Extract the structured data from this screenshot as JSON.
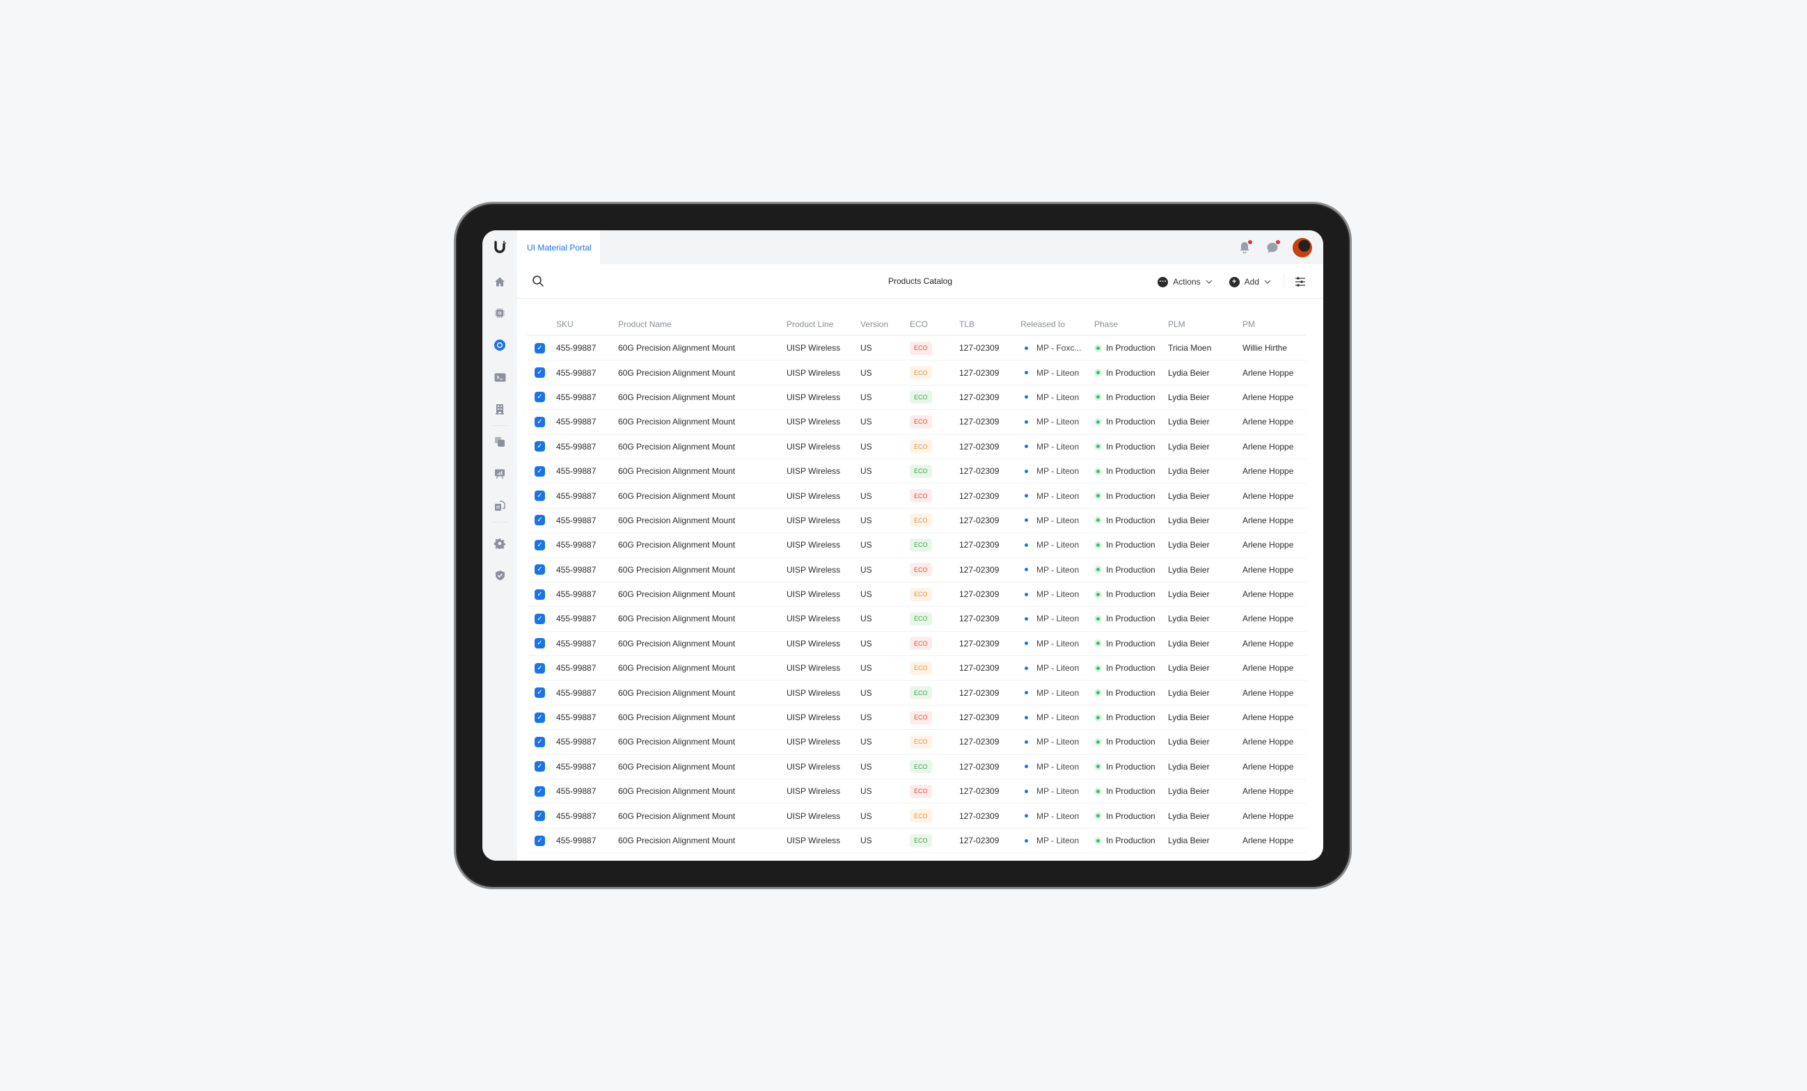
{
  "app": {
    "tab_label": "UI Material Portal",
    "page_title": "Products Catalog"
  },
  "sidebar": {
    "items": [
      {
        "icon": "home-icon",
        "active": false
      },
      {
        "icon": "chip-icon",
        "active": false
      },
      {
        "icon": "circle-icon",
        "active": true
      },
      {
        "icon": "terminal-icon",
        "active": false
      },
      {
        "icon": "building-icon",
        "active": false
      },
      {
        "icon": "copy-icon",
        "active": false
      },
      {
        "icon": "presentation-chart-icon",
        "active": false
      },
      {
        "icon": "documents-icon",
        "active": false
      },
      {
        "icon": "gear-icon",
        "active": false
      },
      {
        "icon": "shield-check-icon",
        "active": false
      }
    ]
  },
  "topbar": {
    "notifications": {
      "icon": "bell-icon",
      "has_unread": true
    },
    "messages": {
      "icon": "chat-icon",
      "has_unread": true
    }
  },
  "toolbar": {
    "actions_label": "Actions",
    "add_label": "Add"
  },
  "colors": {
    "accent": "#1a73e8",
    "eco_red": "#e0513a",
    "eco_orange": "#e39440",
    "eco_green": "#3aa54a",
    "phase_green": "#34c26a"
  },
  "table": {
    "columns": [
      "SKU",
      "Product Name",
      "Product Line",
      "Version",
      "ECO",
      "TLB",
      "Released to",
      "Phase",
      "PLM",
      "PM"
    ],
    "rows": [
      {
        "checked": true,
        "sku": "455-99887",
        "name": "60G Precision Alignment Mount",
        "line": "UISP Wireless",
        "version": "US",
        "eco": "ECO",
        "eco_status": "red",
        "tlb": "127-02309",
        "released": "MP - Foxc...",
        "phase": "In Production",
        "plm": "Tricia Moen",
        "pm": "Willie Hirthe"
      },
      {
        "checked": true,
        "sku": "455-99887",
        "name": "60G Precision Alignment Mount",
        "line": "UISP Wireless",
        "version": "US",
        "eco": "ECO",
        "eco_status": "orange",
        "tlb": "127-02309",
        "released": "MP - Liteon",
        "phase": "In Production",
        "plm": "Lydia Beier",
        "pm": "Arlene Hoppe"
      },
      {
        "checked": true,
        "sku": "455-99887",
        "name": "60G Precision Alignment Mount",
        "line": "UISP Wireless",
        "version": "US",
        "eco": "ECO",
        "eco_status": "green",
        "tlb": "127-02309",
        "released": "MP - Liteon",
        "phase": "In Production",
        "plm": "Lydia Beier",
        "pm": "Arlene Hoppe"
      },
      {
        "checked": true,
        "sku": "455-99887",
        "name": "60G Precision Alignment Mount",
        "line": "UISP Wireless",
        "version": "US",
        "eco": "ECO",
        "eco_status": "red",
        "tlb": "127-02309",
        "released": "MP - Liteon",
        "phase": "In Production",
        "plm": "Lydia Beier",
        "pm": "Arlene Hoppe"
      },
      {
        "checked": true,
        "sku": "455-99887",
        "name": "60G Precision Alignment Mount",
        "line": "UISP Wireless",
        "version": "US",
        "eco": "ECO",
        "eco_status": "orange",
        "tlb": "127-02309",
        "released": "MP - Liteon",
        "phase": "In Production",
        "plm": "Lydia Beier",
        "pm": "Arlene Hoppe"
      },
      {
        "checked": true,
        "sku": "455-99887",
        "name": "60G Precision Alignment Mount",
        "line": "UISP Wireless",
        "version": "US",
        "eco": "ECO",
        "eco_status": "green",
        "tlb": "127-02309",
        "released": "MP - Liteon",
        "phase": "In Production",
        "plm": "Lydia Beier",
        "pm": "Arlene Hoppe"
      },
      {
        "checked": true,
        "sku": "455-99887",
        "name": "60G Precision Alignment Mount",
        "line": "UISP Wireless",
        "version": "US",
        "eco": "ECO",
        "eco_status": "red",
        "tlb": "127-02309",
        "released": "MP - Liteon",
        "phase": "In Production",
        "plm": "Lydia Beier",
        "pm": "Arlene Hoppe"
      },
      {
        "checked": true,
        "sku": "455-99887",
        "name": "60G Precision Alignment Mount",
        "line": "UISP Wireless",
        "version": "US",
        "eco": "ECO",
        "eco_status": "orange",
        "tlb": "127-02309",
        "released": "MP - Liteon",
        "phase": "In Production",
        "plm": "Lydia Beier",
        "pm": "Arlene Hoppe"
      },
      {
        "checked": true,
        "sku": "455-99887",
        "name": "60G Precision Alignment Mount",
        "line": "UISP Wireless",
        "version": "US",
        "eco": "ECO",
        "eco_status": "green",
        "tlb": "127-02309",
        "released": "MP - Liteon",
        "phase": "In Production",
        "plm": "Lydia Beier",
        "pm": "Arlene Hoppe"
      },
      {
        "checked": true,
        "sku": "455-99887",
        "name": "60G Precision Alignment Mount",
        "line": "UISP Wireless",
        "version": "US",
        "eco": "ECO",
        "eco_status": "red",
        "tlb": "127-02309",
        "released": "MP - Liteon",
        "phase": "In Production",
        "plm": "Lydia Beier",
        "pm": "Arlene Hoppe"
      },
      {
        "checked": true,
        "sku": "455-99887",
        "name": "60G Precision Alignment Mount",
        "line": "UISP Wireless",
        "version": "US",
        "eco": "ECO",
        "eco_status": "orange",
        "tlb": "127-02309",
        "released": "MP - Liteon",
        "phase": "In Production",
        "plm": "Lydia Beier",
        "pm": "Arlene Hoppe"
      },
      {
        "checked": true,
        "sku": "455-99887",
        "name": "60G Precision Alignment Mount",
        "line": "UISP Wireless",
        "version": "US",
        "eco": "ECO",
        "eco_status": "green",
        "tlb": "127-02309",
        "released": "MP - Liteon",
        "phase": "In Production",
        "plm": "Lydia Beier",
        "pm": "Arlene Hoppe"
      },
      {
        "checked": true,
        "sku": "455-99887",
        "name": "60G Precision Alignment Mount",
        "line": "UISP Wireless",
        "version": "US",
        "eco": "ECO",
        "eco_status": "red",
        "tlb": "127-02309",
        "released": "MP - Liteon",
        "phase": "In Production",
        "plm": "Lydia Beier",
        "pm": "Arlene Hoppe"
      },
      {
        "checked": true,
        "sku": "455-99887",
        "name": "60G Precision Alignment Mount",
        "line": "UISP Wireless",
        "version": "US",
        "eco": "ECO",
        "eco_status": "orange",
        "tlb": "127-02309",
        "released": "MP - Liteon",
        "phase": "In Production",
        "plm": "Lydia Beier",
        "pm": "Arlene Hoppe"
      },
      {
        "checked": true,
        "sku": "455-99887",
        "name": "60G Precision Alignment Mount",
        "line": "UISP Wireless",
        "version": "US",
        "eco": "ECO",
        "eco_status": "green",
        "tlb": "127-02309",
        "released": "MP - Liteon",
        "phase": "In Production",
        "plm": "Lydia Beier",
        "pm": "Arlene Hoppe"
      },
      {
        "checked": true,
        "sku": "455-99887",
        "name": "60G Precision Alignment Mount",
        "line": "UISP Wireless",
        "version": "US",
        "eco": "ECO",
        "eco_status": "red",
        "tlb": "127-02309",
        "released": "MP - Liteon",
        "phase": "In Production",
        "plm": "Lydia Beier",
        "pm": "Arlene Hoppe"
      },
      {
        "checked": true,
        "sku": "455-99887",
        "name": "60G Precision Alignment Mount",
        "line": "UISP Wireless",
        "version": "US",
        "eco": "ECO",
        "eco_status": "orange",
        "tlb": "127-02309",
        "released": "MP - Liteon",
        "phase": "In Production",
        "plm": "Lydia Beier",
        "pm": "Arlene Hoppe"
      },
      {
        "checked": true,
        "sku": "455-99887",
        "name": "60G Precision Alignment Mount",
        "line": "UISP Wireless",
        "version": "US",
        "eco": "ECO",
        "eco_status": "green",
        "tlb": "127-02309",
        "released": "MP - Liteon",
        "phase": "In Production",
        "plm": "Lydia Beier",
        "pm": "Arlene Hoppe"
      },
      {
        "checked": true,
        "sku": "455-99887",
        "name": "60G Precision Alignment Mount",
        "line": "UISP Wireless",
        "version": "US",
        "eco": "ECO",
        "eco_status": "red",
        "tlb": "127-02309",
        "released": "MP - Liteon",
        "phase": "In Production",
        "plm": "Lydia Beier",
        "pm": "Arlene Hoppe"
      },
      {
        "checked": true,
        "sku": "455-99887",
        "name": "60G Precision Alignment Mount",
        "line": "UISP Wireless",
        "version": "US",
        "eco": "ECO",
        "eco_status": "orange",
        "tlb": "127-02309",
        "released": "MP - Liteon",
        "phase": "In Production",
        "plm": "Lydia Beier",
        "pm": "Arlene Hoppe"
      },
      {
        "checked": true,
        "sku": "455-99887",
        "name": "60G Precision Alignment Mount",
        "line": "UISP Wireless",
        "version": "US",
        "eco": "ECO",
        "eco_status": "green",
        "tlb": "127-02309",
        "released": "MP - Liteon",
        "phase": "In Production",
        "plm": "Lydia Beier",
        "pm": "Arlene Hoppe"
      }
    ]
  }
}
